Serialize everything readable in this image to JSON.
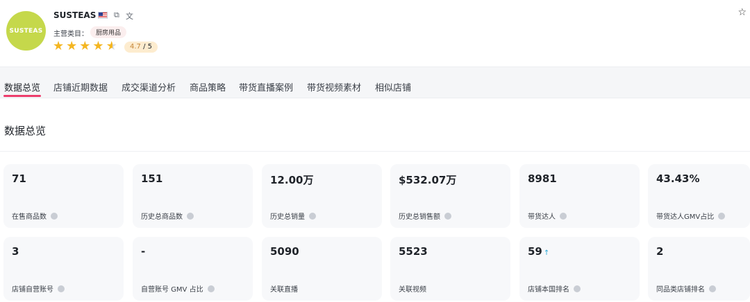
{
  "shop": {
    "name": "SUSTEAS",
    "logo_text": "SUSTEAS",
    "category_label": "主营类目：",
    "category": "厨房用品",
    "rating": "4.7",
    "rating_max": "/ 5",
    "stars_value": 4.7,
    "icons": [
      "us-flag-icon",
      "copy-icon",
      "translate-icon",
      "star-outline-icon"
    ]
  },
  "tabs": [
    "数据总览",
    "店铺近期数据",
    "成交渠道分析",
    "商品策略",
    "带货直播案例",
    "带货视频素材",
    "相似店铺"
  ],
  "active_tab": "数据总览",
  "section_title": "数据总览",
  "stats": [
    {
      "value": "71",
      "label": "在售商品数"
    },
    {
      "value": "151",
      "label": "历史总商品数"
    },
    {
      "value": "12.00万",
      "label": "历史总销量"
    },
    {
      "value": "$532.07万",
      "label": "历史总销售额"
    },
    {
      "value": "8981",
      "label": "带货达人"
    },
    {
      "value": "43.43%",
      "label": "带货达人GMV占比"
    },
    {
      "value": "3",
      "label": "店铺自营账号"
    },
    {
      "value": "-",
      "label": "自营账号 GMV 占比"
    },
    {
      "value": "5090",
      "label": "关联直播"
    },
    {
      "value": "5523",
      "label": "关联视频"
    },
    {
      "value": "59",
      "label": "店铺本国排名",
      "trend": "↑"
    },
    {
      "value": "2",
      "label": "同品类店铺排名"
    }
  ],
  "colors": {
    "accent": "#ec3d6c",
    "star": "#f4b622",
    "logo_bg": "#c5d84b",
    "card_bg": "#f7f8fa",
    "trend": "#2aa8d6"
  }
}
